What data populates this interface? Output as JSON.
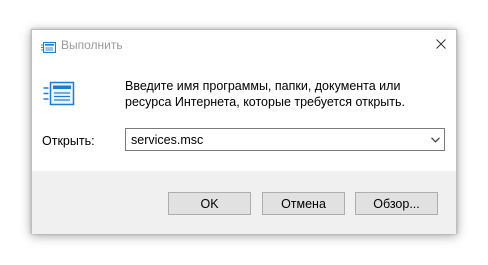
{
  "window": {
    "title": "Выполнить",
    "close_icon": "close-icon",
    "app_icon": "run-icon"
  },
  "main": {
    "instruction": "Введите имя программы, папки, документа или ресурса Интернета, которые требуется открыть.",
    "open_label": "Открыть:",
    "open_value": "services.msc",
    "dropdown_icon": "chevron-down-icon"
  },
  "buttons": {
    "ok_label": "OK",
    "cancel_label": "Отмена",
    "browse_label": "Обзор..."
  },
  "colors": {
    "accent_blue": "#1e7bd2",
    "footer_bg": "#f0f0f0",
    "button_bg": "#e1e1e1"
  }
}
